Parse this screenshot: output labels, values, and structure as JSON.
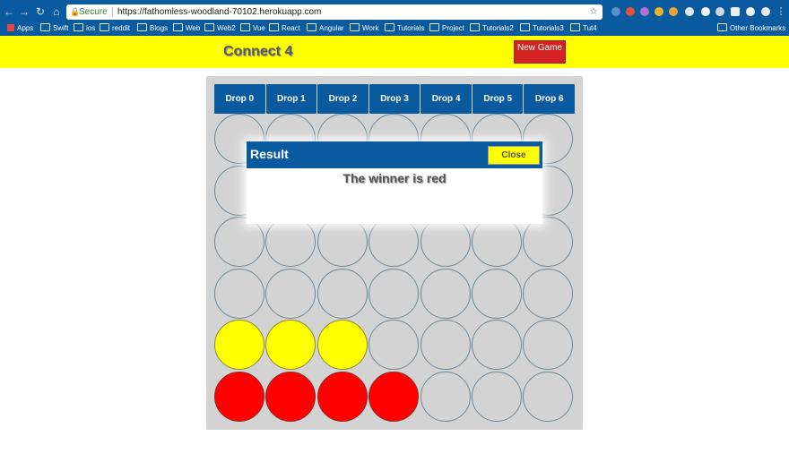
{
  "browser": {
    "secure_label": "Secure",
    "url": "https://fathomless-woodland-70102.herokuapp.com",
    "bookmarks": [
      "Apps",
      "Swift",
      "ios",
      "reddit",
      "Blogs",
      "Web",
      "Web2",
      "Vue",
      "React",
      "Angular",
      "Work",
      "Tutorials",
      "Project",
      "Tutorials2",
      "Tutorials3",
      "Tut4"
    ],
    "other_bookmarks": "Other Bookmarks"
  },
  "app": {
    "title": "Connect 4",
    "new_game_label": "New Game"
  },
  "board": {
    "drop_buttons": [
      "Drop 0",
      "Drop 1",
      "Drop 2",
      "Drop 3",
      "Drop 4",
      "Drop 5",
      "Drop 6"
    ],
    "rows": [
      [
        "empty",
        "empty",
        "empty",
        "empty",
        "empty",
        "empty",
        "empty"
      ],
      [
        "empty",
        "empty",
        "empty",
        "empty",
        "empty",
        "empty",
        "empty"
      ],
      [
        "empty",
        "empty",
        "empty",
        "empty",
        "empty",
        "empty",
        "empty"
      ],
      [
        "empty",
        "empty",
        "empty",
        "empty",
        "empty",
        "empty",
        "empty"
      ],
      [
        "yellow",
        "yellow",
        "yellow",
        "empty",
        "empty",
        "empty",
        "empty"
      ],
      [
        "red",
        "red",
        "red",
        "red",
        "empty",
        "empty",
        "empty"
      ]
    ]
  },
  "modal": {
    "title": "Result",
    "close_label": "Close",
    "message": "The winner is red"
  },
  "colors": {
    "header_yellow": "#ffff00",
    "brand_blue": "#0a5aa0",
    "new_game_red": "#d32222",
    "piece_red": "#ff0000",
    "piece_yellow": "#ffff00",
    "board_gray": "#d3d3d3"
  }
}
